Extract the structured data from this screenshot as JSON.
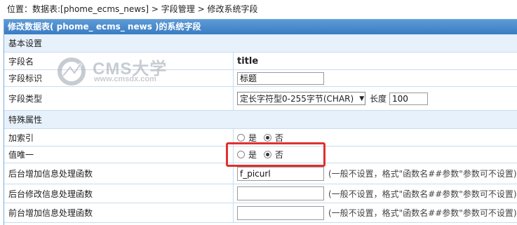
{
  "breadcrumb": {
    "prefix": "位置：",
    "link1": "数据表:[phome_ecms_news]",
    "sep1": " > ",
    "link2": "字段管理",
    "sep2": " > ",
    "current": "修改系统字段"
  },
  "header": {
    "title": "修改数据表( phome_ ecms_ news )的系统字段"
  },
  "sections": {
    "basic": "基本设置",
    "special": "特殊属性"
  },
  "fields": {
    "name_label": "字段名",
    "name_value": "title",
    "ident_label": "字段标识",
    "ident_value": "标题",
    "type_label": "字段类型",
    "type_selected": "定长字符型0-255字节(CHAR)",
    "length_label": "长度",
    "length_value": "100"
  },
  "special": {
    "index_label": "加索引",
    "unique_label": "值唯一",
    "yes": "是",
    "no": "否",
    "index_value": "否",
    "unique_value": "否",
    "add_func_label": "后台增加信息处理函数",
    "add_func_value": "f_picurl",
    "edit_func_label": "后台修改信息处理函数",
    "edit_func_value": "",
    "front_add_func_label": "前台增加信息处理函数",
    "front_add_func_value": "",
    "hint": "(一般不设置，格式\"函数名##参数\"参数可不设置)"
  },
  "watermark": {
    "brand": "CMS大学",
    "url": "www.cmsdx.com"
  },
  "icons": {
    "select_arrow": "chevron-down-icon",
    "watermark_logo": "cms-logo-icon"
  },
  "colors": {
    "header_bg": "#4a8bd0",
    "section_bg": "#e7f1fb",
    "highlight": "#e03030"
  }
}
